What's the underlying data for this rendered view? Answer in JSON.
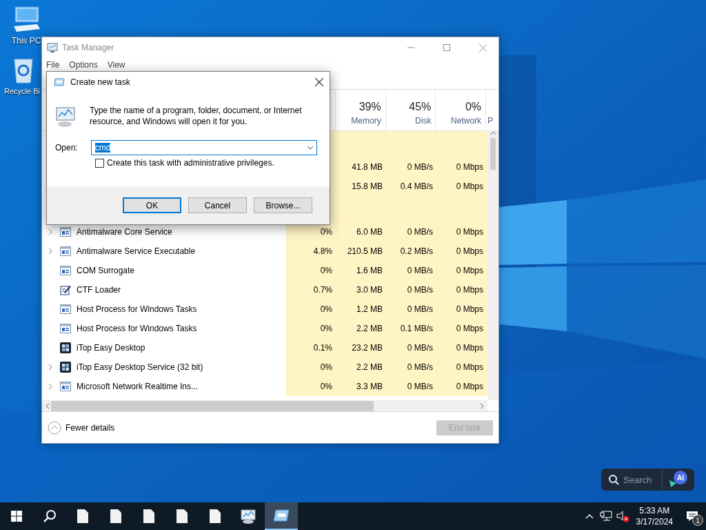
{
  "desktop": {
    "icons": [
      {
        "label": "This PC",
        "kind": "pc"
      },
      {
        "label": "Recycle Bi",
        "kind": "bin"
      }
    ]
  },
  "task_manager": {
    "title": "Task Manager",
    "menu": [
      "File",
      "Options",
      "View"
    ],
    "columns": [
      {
        "percent": "39%",
        "label": "Memory"
      },
      {
        "percent": "45%",
        "label": "Disk"
      },
      {
        "percent": "0%",
        "label": "Network"
      },
      {
        "label": "P"
      }
    ],
    "rows": [
      {
        "kind": "group"
      },
      {
        "kind": "process",
        "memory": "41.8 MB",
        "disk": "0 MB/s",
        "network": "0 Mbps"
      },
      {
        "kind": "process",
        "memory": "15.8 MB",
        "disk": "0.4 MB/s",
        "network": "0 Mbps"
      },
      {
        "kind": "group"
      },
      {
        "kind": "process",
        "name": "Antimalware Core Service",
        "icon": {
          "kind": "window"
        },
        "expandable": true,
        "cpu": "0%",
        "memory": "6.0 MB",
        "disk": "0 MB/s",
        "network": "0 Mbps"
      },
      {
        "kind": "process",
        "name": "Antimalware Service Executable",
        "icon": {
          "kind": "window"
        },
        "expandable": true,
        "cpu": "4.8%",
        "memory": "210.5 MB",
        "disk": "0.2 MB/s",
        "network": "0 Mbps"
      },
      {
        "kind": "process",
        "name": "COM Surrogate",
        "icon": {
          "kind": "window"
        },
        "expandable": false,
        "cpu": "0%",
        "memory": "1.6 MB",
        "disk": "0 MB/s",
        "network": "0 Mbps"
      },
      {
        "kind": "process",
        "name": "CTF Loader",
        "icon": {
          "kind": "pen"
        },
        "expandable": false,
        "cpu": "0.7%",
        "memory": "3.0 MB",
        "disk": "0 MB/s",
        "network": "0 Mbps"
      },
      {
        "kind": "process",
        "name": "Host Process for Windows Tasks",
        "icon": {
          "kind": "window"
        },
        "expandable": false,
        "cpu": "0%",
        "memory": "1.2 MB",
        "disk": "0 MB/s",
        "network": "0 Mbps"
      },
      {
        "kind": "process",
        "name": "Host Process for Windows Tasks",
        "icon": {
          "kind": "window"
        },
        "expandable": false,
        "cpu": "0%",
        "memory": "2.2 MB",
        "disk": "0.1 MB/s",
        "network": "0 Mbps"
      },
      {
        "kind": "process",
        "name": "iTop Easy Desktop",
        "icon": {
          "kind": "tiles"
        },
        "expandable": false,
        "cpu": "0.1%",
        "memory": "23.2 MB",
        "disk": "0 MB/s",
        "network": "0 Mbps"
      },
      {
        "kind": "process",
        "name": "iTop Easy Desktop Service (32 bit)",
        "icon": {
          "kind": "tiles"
        },
        "expandable": true,
        "cpu": "0%",
        "memory": "2.2 MB",
        "disk": "0 MB/s",
        "network": "0 Mbps"
      },
      {
        "kind": "process",
        "name": "Microsoft Network Realtime Ins...",
        "icon": {
          "kind": "window"
        },
        "expandable": true,
        "cpu": "0%",
        "memory": "3.3 MB",
        "disk": "0 MB/s",
        "network": "0 Mbps"
      }
    ],
    "fewer_details": "Fewer details",
    "end_task": {
      "label": "End task",
      "disabled": true
    }
  },
  "dialog": {
    "title": "Create new task",
    "message": "Type the name of a program, folder, document, or Internet resource, and Windows will open it for you.",
    "open_label": "Open:",
    "value": "cmd",
    "value_selected": true,
    "admin": {
      "label": "Create this task with administrative privileges.",
      "checked": false
    },
    "buttons": [
      {
        "label": "OK",
        "default": true
      },
      {
        "label": "Cancel",
        "default": false
      },
      {
        "label": "Browse...",
        "default": false
      }
    ]
  },
  "search_widget": {
    "placeholder": "Search",
    "assistant": "AI"
  },
  "taskbar": {
    "apps": [
      {
        "kind": "start",
        "active": false
      },
      {
        "kind": "search",
        "active": false
      },
      {
        "kind": "document",
        "active": false
      },
      {
        "kind": "document",
        "active": false
      },
      {
        "kind": "document",
        "active": false
      },
      {
        "kind": "document",
        "active": false
      },
      {
        "kind": "document",
        "active": false
      },
      {
        "kind": "task-manager",
        "active": false
      },
      {
        "kind": "run",
        "active": true
      }
    ],
    "tray": {
      "volume_muted": true,
      "time": "5:33 AM",
      "date": "3/17/2024",
      "notifications": "1"
    }
  }
}
